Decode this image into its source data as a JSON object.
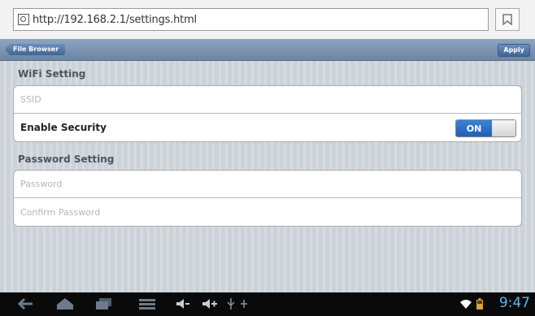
{
  "browser": {
    "url": "http://192.168.2.1/settings.html"
  },
  "toolbar": {
    "back_label": "File Browser",
    "apply_label": "Apply"
  },
  "wifi": {
    "section_title": "WiFi Setting",
    "ssid_placeholder": "SSID",
    "security_label": "Enable Security",
    "security_toggle": "ON"
  },
  "password": {
    "section_title": "Password Setting",
    "password_placeholder": "Password",
    "confirm_placeholder": "Confirm Password"
  },
  "statusbar": {
    "time": "9:47"
  },
  "colors": {
    "accent": "#2a6fc9",
    "clock": "#5fb6e8"
  }
}
